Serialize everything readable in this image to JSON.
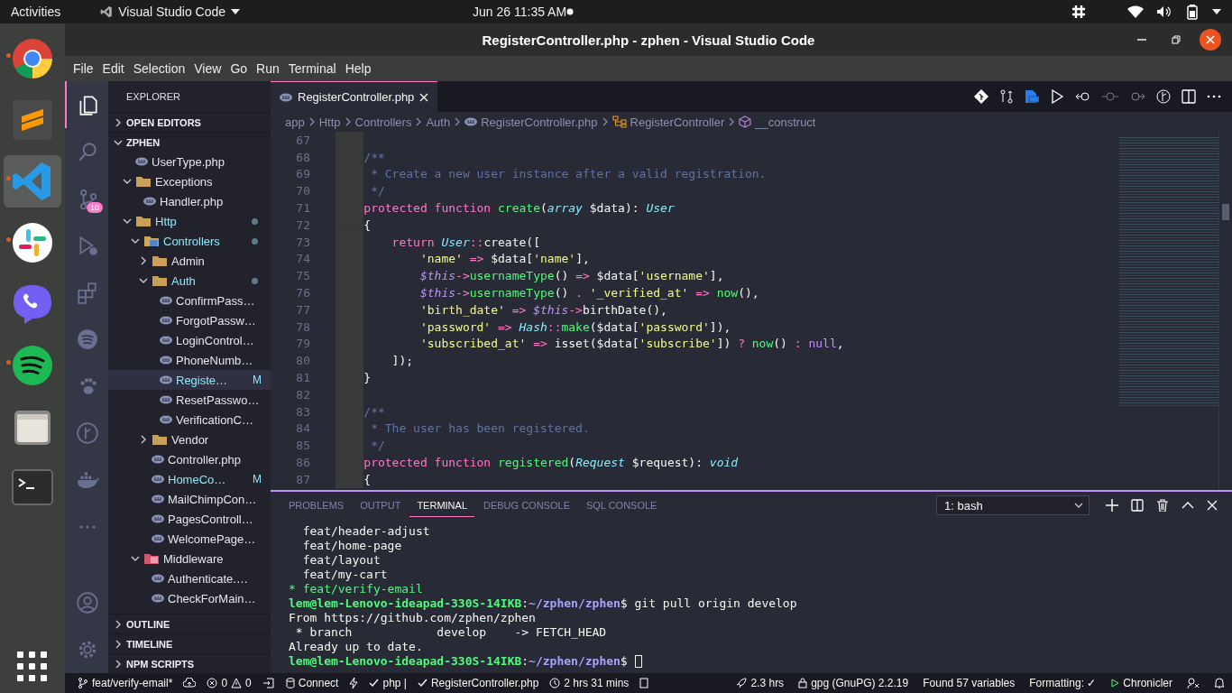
{
  "top_bar": {
    "activities": "Activities",
    "app_menu": "Visual Studio Code",
    "clock": "Jun 26  11:35 AM"
  },
  "dock": {
    "items": [
      {
        "kind": "browser",
        "running": true,
        "selected": false
      },
      {
        "kind": "text-editor",
        "running": false,
        "selected": false
      },
      {
        "kind": "code-editor",
        "running": true,
        "selected": true
      },
      {
        "kind": "chat",
        "running": true,
        "selected": false
      },
      {
        "kind": "phone",
        "running": false,
        "selected": false
      },
      {
        "kind": "music",
        "running": true,
        "selected": false
      },
      {
        "kind": "files",
        "running": false,
        "selected": false
      },
      {
        "kind": "terminal",
        "running": false,
        "selected": false
      }
    ]
  },
  "window": {
    "title": "RegisterController.php - zphen - Visual Studio Code"
  },
  "menu": [
    "File",
    "Edit",
    "Selection",
    "View",
    "Go",
    "Run",
    "Terminal",
    "Help"
  ],
  "activity_bar": {
    "items": [
      {
        "kind": "explorer",
        "selected": true
      },
      {
        "kind": "search",
        "selected": false
      },
      {
        "kind": "source-control",
        "selected": false,
        "badge": "10"
      },
      {
        "kind": "debug",
        "selected": false
      },
      {
        "kind": "extensions",
        "selected": false
      },
      {
        "kind": "sound-waves",
        "selected": false
      },
      {
        "kind": "paw",
        "selected": false
      },
      {
        "kind": "branch-graph",
        "selected": false
      },
      {
        "kind": "whale",
        "selected": false
      },
      {
        "kind": "more",
        "selected": false
      }
    ],
    "bottom": [
      {
        "kind": "account",
        "selected": false
      },
      {
        "kind": "settings",
        "selected": false
      }
    ]
  },
  "sidebar": {
    "title": "EXPLORER",
    "sections": [
      {
        "label": "OPEN EDITORS",
        "expanded": false
      },
      {
        "label": "ZPHEN",
        "expanded": true,
        "tree": [
          {
            "label": "UserType.php",
            "kind": "file",
            "selected": false,
            "modified": false
          },
          {
            "label": "Exceptions",
            "kind": "folder",
            "expanded": true,
            "selected": false,
            "modified": false,
            "children": [
              {
                "label": "Handler.php",
                "kind": "file",
                "selected": false,
                "modified": false
              }
            ]
          },
          {
            "label": "Http",
            "kind": "folder",
            "expanded": true,
            "selected": false,
            "modified": true,
            "children": [
              {
                "label": "Controllers",
                "kind": "controllers-folder",
                "expanded": true,
                "selected": false,
                "modified": true,
                "children": [
                  {
                    "label": "Admin",
                    "kind": "folder",
                    "expanded": false,
                    "selected": false,
                    "modified": false
                  },
                  {
                    "label": "Auth",
                    "kind": "folder",
                    "expanded": true,
                    "selected": false,
                    "modified": true,
                    "children": [
                      {
                        "label": "ConfirmPass…",
                        "kind": "file",
                        "selected": false,
                        "modified": false
                      },
                      {
                        "label": "ForgotPassw…",
                        "kind": "file",
                        "selected": false,
                        "modified": false
                      },
                      {
                        "label": "LoginControl…",
                        "kind": "file",
                        "selected": false,
                        "modified": false
                      },
                      {
                        "label": "PhoneNumb…",
                        "kind": "file",
                        "selected": false,
                        "modified": false
                      },
                      {
                        "label": "Registe…",
                        "kind": "file",
                        "selected": true,
                        "modified": true,
                        "badge": "M"
                      },
                      {
                        "label": "ResetPasswo…",
                        "kind": "file",
                        "selected": false,
                        "modified": false
                      },
                      {
                        "label": "VerificationC…",
                        "kind": "file",
                        "selected": false,
                        "modified": false
                      }
                    ]
                  },
                  {
                    "label": "Vendor",
                    "kind": "folder",
                    "expanded": false,
                    "selected": false,
                    "modified": false
                  },
                  {
                    "label": "Controller.php",
                    "kind": "file",
                    "selected": false,
                    "modified": false
                  },
                  {
                    "label": "HomeCo…",
                    "kind": "file",
                    "selected": false,
                    "modified": true,
                    "badge": "M"
                  },
                  {
                    "label": "MailChimpCon…",
                    "kind": "file",
                    "selected": false,
                    "modified": false
                  },
                  {
                    "label": "PagesControll…",
                    "kind": "file",
                    "selected": false,
                    "modified": false
                  },
                  {
                    "label": "WelcomePage…",
                    "kind": "file",
                    "selected": false,
                    "modified": false
                  }
                ]
              },
              {
                "label": "Middleware",
                "kind": "middleware-folder",
                "expanded": true,
                "selected": false,
                "modified": false,
                "children": [
                  {
                    "label": "Authenticate.…",
                    "kind": "file",
                    "selected": false,
                    "modified": false
                  },
                  {
                    "label": "CheckForMain…",
                    "kind": "file",
                    "selected": false,
                    "modified": false
                  }
                ]
              }
            ]
          }
        ]
      },
      {
        "label": "OUTLINE",
        "expanded": false
      },
      {
        "label": "TIMELINE",
        "expanded": false
      },
      {
        "label": "NPM SCRIPTS",
        "expanded": false
      }
    ]
  },
  "editor": {
    "tabs": [
      {
        "label": "RegisterController.php",
        "selected": true
      }
    ],
    "breadcrumbs": [
      {
        "label": "app",
        "kind": "folder"
      },
      {
        "label": "Http",
        "kind": "folder"
      },
      {
        "label": "Controllers",
        "kind": "folder"
      },
      {
        "label": "Auth",
        "kind": "folder"
      },
      {
        "label": "RegisterController.php",
        "kind": "file"
      },
      {
        "label": "RegisterController",
        "kind": "class"
      },
      {
        "label": "__construct",
        "kind": "method"
      }
    ],
    "lines": [
      {
        "number": "67"
      },
      {
        "number": "68",
        "tokens": [
          {
            "text": "    /**",
            "kind": "comment"
          }
        ]
      },
      {
        "number": "69",
        "tokens": [
          {
            "text": "     * Create a new user instance after a valid registration.",
            "kind": "comment"
          }
        ]
      },
      {
        "number": "70",
        "tokens": [
          {
            "text": "     */",
            "kind": "comment"
          }
        ]
      },
      {
        "number": "71",
        "tokens": [
          {
            "text": "    protected function ",
            "kind": "keyword"
          },
          {
            "text": "create",
            "kind": "function"
          },
          {
            "text": "(",
            "kind": "plain"
          },
          {
            "text": "array",
            "kind": "class"
          },
          {
            "text": " $data): ",
            "kind": "plain"
          },
          {
            "text": "User",
            "kind": "class"
          }
        ]
      },
      {
        "number": "72",
        "tokens": [
          {
            "text": "    {",
            "kind": "plain"
          }
        ]
      },
      {
        "number": "73",
        "tokens": [
          {
            "text": "        return ",
            "kind": "keyword"
          },
          {
            "text": "User",
            "kind": "class"
          },
          {
            "text": "::",
            "kind": "keyword"
          },
          {
            "text": "create([",
            "kind": "plain"
          }
        ]
      },
      {
        "number": "74",
        "tokens": [
          {
            "text": "            'name'",
            "kind": "string"
          },
          {
            "text": " => ",
            "kind": "keyword"
          },
          {
            "text": "$data[",
            "kind": "plain"
          },
          {
            "text": "'name'",
            "kind": "string"
          },
          {
            "text": "],",
            "kind": "plain"
          }
        ]
      },
      {
        "number": "75",
        "tokens": [
          {
            "text": "            $this",
            "kind": "this"
          },
          {
            "text": "->",
            "kind": "keyword"
          },
          {
            "text": "usernameType",
            "kind": "function"
          },
          {
            "text": "() ",
            "kind": "plain"
          },
          {
            "text": "=>",
            "kind": "keyword"
          },
          {
            "text": " $data[",
            "kind": "plain"
          },
          {
            "text": "'username'",
            "kind": "string"
          },
          {
            "text": "],",
            "kind": "plain"
          }
        ]
      },
      {
        "number": "76",
        "tokens": [
          {
            "text": "            $this",
            "kind": "this"
          },
          {
            "text": "->",
            "kind": "keyword"
          },
          {
            "text": "usernameType",
            "kind": "function"
          },
          {
            "text": "() ",
            "kind": "plain"
          },
          {
            "text": ". ",
            "kind": "keyword"
          },
          {
            "text": "'_verified_at'",
            "kind": "string"
          },
          {
            "text": " => ",
            "kind": "keyword"
          },
          {
            "text": "now",
            "kind": "function"
          },
          {
            "text": "(),",
            "kind": "plain"
          }
        ]
      },
      {
        "number": "77",
        "tokens": [
          {
            "text": "            'birth_date'",
            "kind": "string"
          },
          {
            "text": " => ",
            "kind": "keyword"
          },
          {
            "text": "$this",
            "kind": "this"
          },
          {
            "text": "->",
            "kind": "keyword"
          },
          {
            "text": "birthDate(),",
            "kind": "plain"
          }
        ]
      },
      {
        "number": "78",
        "tokens": [
          {
            "text": "            'password'",
            "kind": "string"
          },
          {
            "text": " => ",
            "kind": "keyword"
          },
          {
            "text": "Hash",
            "kind": "class"
          },
          {
            "text": "::",
            "kind": "keyword"
          },
          {
            "text": "make",
            "kind": "function"
          },
          {
            "text": "($data[",
            "kind": "plain"
          },
          {
            "text": "'password'",
            "kind": "string"
          },
          {
            "text": "]),",
            "kind": "plain"
          }
        ]
      },
      {
        "number": "79",
        "tokens": [
          {
            "text": "            'subscribed_at'",
            "kind": "string"
          },
          {
            "text": " => ",
            "kind": "keyword"
          },
          {
            "text": "isset($data[",
            "kind": "plain"
          },
          {
            "text": "'subscribe'",
            "kind": "string"
          },
          {
            "text": "]) ",
            "kind": "plain"
          },
          {
            "text": "? ",
            "kind": "keyword"
          },
          {
            "text": "now",
            "kind": "function"
          },
          {
            "text": "() ",
            "kind": "plain"
          },
          {
            "text": ": ",
            "kind": "keyword"
          },
          {
            "text": "null",
            "kind": "constant"
          },
          {
            "text": ",",
            "kind": "plain"
          }
        ]
      },
      {
        "number": "80",
        "tokens": [
          {
            "text": "        ]);",
            "kind": "plain"
          }
        ]
      },
      {
        "number": "81",
        "tokens": [
          {
            "text": "    }",
            "kind": "plain"
          }
        ]
      },
      {
        "number": "82"
      },
      {
        "number": "83",
        "tokens": [
          {
            "text": "    /**",
            "kind": "comment"
          }
        ]
      },
      {
        "number": "84",
        "tokens": [
          {
            "text": "     * The user has been registered.",
            "kind": "comment"
          }
        ]
      },
      {
        "number": "85",
        "tokens": [
          {
            "text": "     */",
            "kind": "comment"
          }
        ]
      },
      {
        "number": "86",
        "tokens": [
          {
            "text": "    protected function ",
            "kind": "keyword"
          },
          {
            "text": "registered",
            "kind": "function"
          },
          {
            "text": "(",
            "kind": "plain"
          },
          {
            "text": "Request",
            "kind": "class"
          },
          {
            "text": " $request): ",
            "kind": "plain"
          },
          {
            "text": "void",
            "kind": "class"
          }
        ]
      },
      {
        "number": "87",
        "tokens": [
          {
            "text": "    {",
            "kind": "plain"
          }
        ]
      }
    ]
  },
  "panel": {
    "tabs": [
      {
        "label": "PROBLEMS",
        "selected": false
      },
      {
        "label": "OUTPUT",
        "selected": false
      },
      {
        "label": "TERMINAL",
        "selected": true
      },
      {
        "label": "DEBUG CONSOLE",
        "selected": false
      },
      {
        "label": "SQL CONSOLE",
        "selected": false
      }
    ],
    "terminal_select": "1: bash",
    "lines": [
      {
        "tokens": [
          {
            "text": "  feat/header-adjust",
            "kind": "plain"
          }
        ]
      },
      {
        "tokens": [
          {
            "text": "  feat/home-page",
            "kind": "plain"
          }
        ]
      },
      {
        "tokens": [
          {
            "text": "  feat/layout",
            "kind": "plain"
          }
        ]
      },
      {
        "tokens": [
          {
            "text": "  feat/my-cart",
            "kind": "plain"
          }
        ]
      },
      {
        "tokens": [
          {
            "text": "* feat/verify-email",
            "kind": "current"
          }
        ]
      },
      {
        "tokens": [
          {
            "text": "lem@lem-Lenovo-ideapad-330S-14IKB",
            "kind": "user"
          },
          {
            "text": ":",
            "kind": "plain"
          },
          {
            "text": "~/zphen/zphen",
            "kind": "path"
          },
          {
            "text": "$ git pull origin develop",
            "kind": "plain"
          }
        ]
      },
      {
        "tokens": [
          {
            "text": "From https://github.com/zphen/zphen",
            "kind": "plain"
          }
        ]
      },
      {
        "tokens": [
          {
            "text": " * branch            develop    -> FETCH_HEAD",
            "kind": "plain"
          }
        ]
      },
      {
        "tokens": [
          {
            "text": "Already up to date.",
            "kind": "plain"
          }
        ]
      },
      {
        "tokens": [
          {
            "text": "lem@lem-Lenovo-ideapad-330S-14IKB",
            "kind": "user"
          },
          {
            "text": ":",
            "kind": "plain"
          },
          {
            "text": "~/zphen/zphen",
            "kind": "path"
          },
          {
            "text": "$ ",
            "kind": "plain"
          }
        ],
        "cursor": true
      }
    ]
  },
  "status_bar": {
    "branch": "feat/verify-email*",
    "errors": "0",
    "warnings": "0",
    "connect": "Connect",
    "language": "php |",
    "file": "RegisterController.php",
    "session": "2 hrs 31 mins",
    "hours": "2.3 hrs",
    "gpg": "gpg (GnuPG) 2.2.19",
    "variables": "Found 57 variables",
    "formatting": "Formatting: ✓",
    "chronicler": "Chronicler"
  }
}
